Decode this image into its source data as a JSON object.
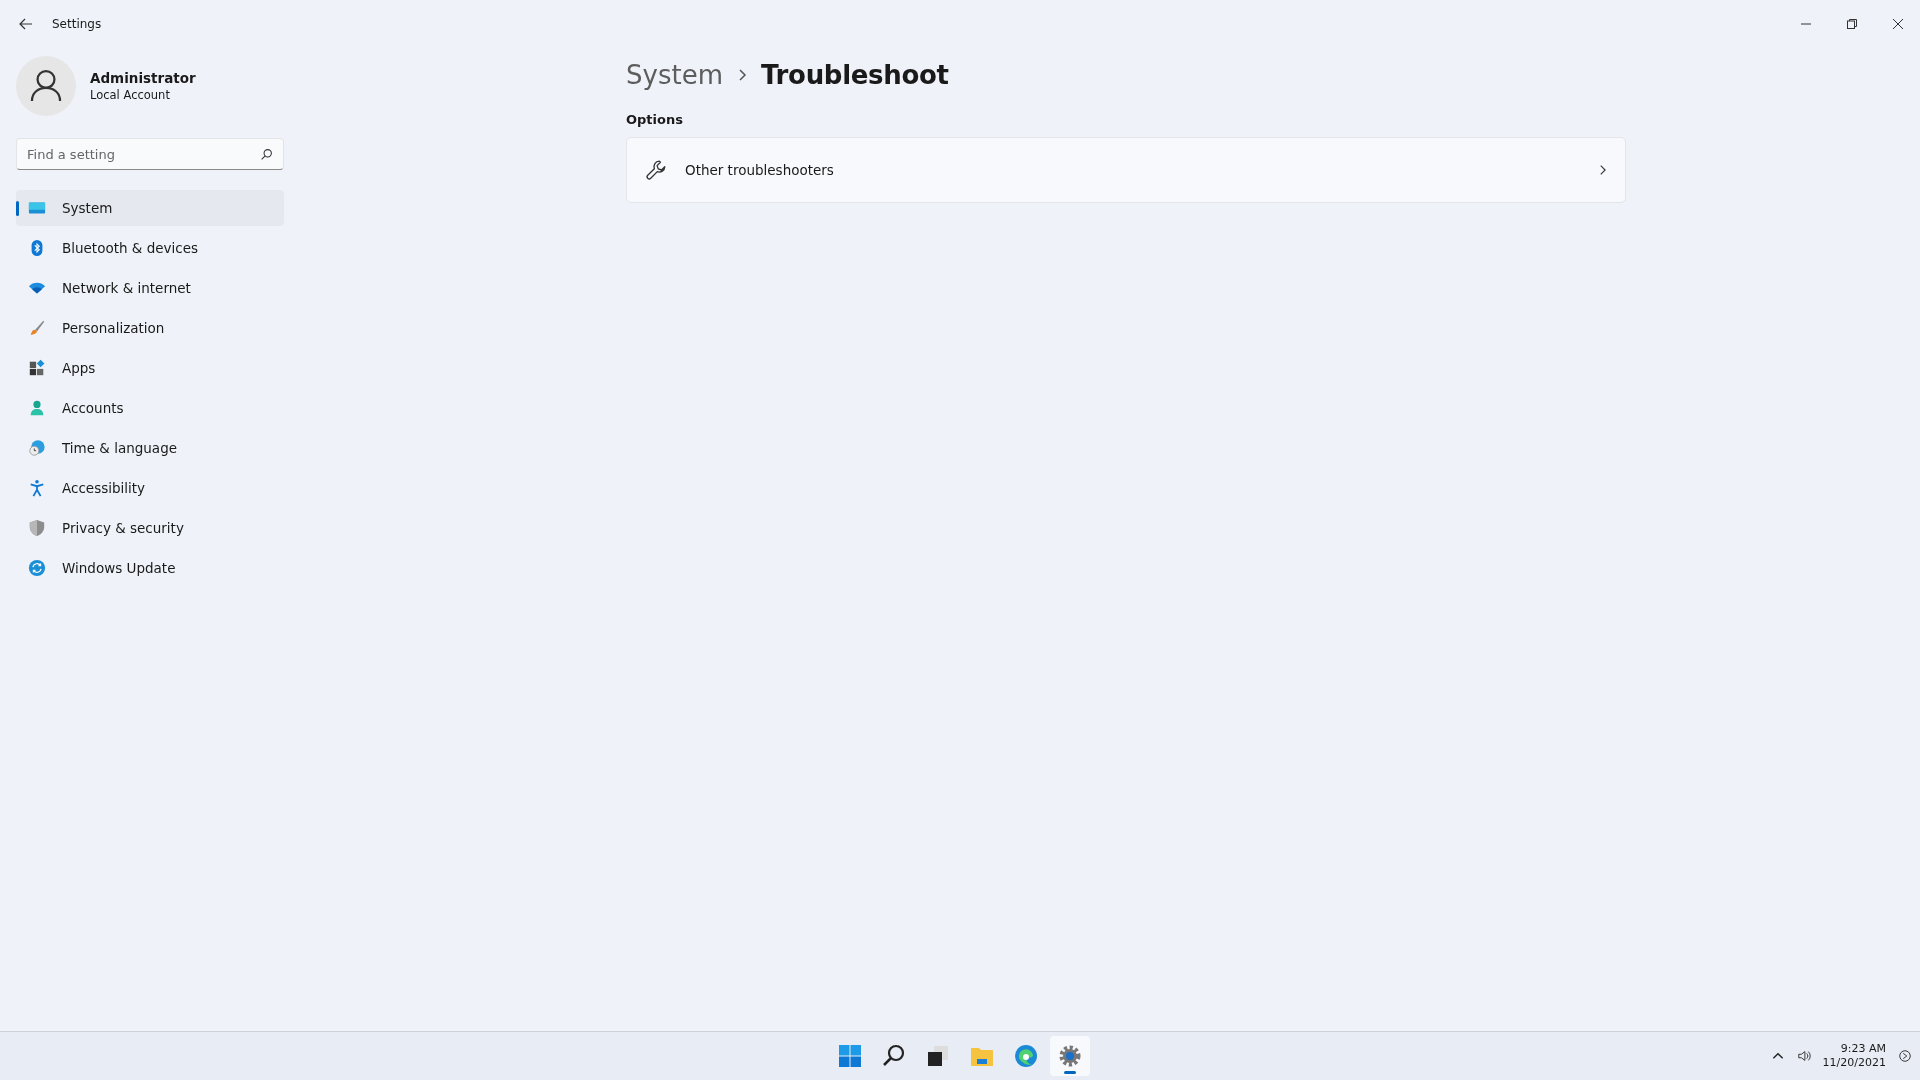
{
  "window": {
    "title": "Settings"
  },
  "account": {
    "name": "Administrator",
    "type": "Local Account"
  },
  "search": {
    "placeholder": "Find a setting"
  },
  "sidebar": {
    "items": [
      {
        "label": "System",
        "kind": "monitor",
        "selected": true
      },
      {
        "label": "Bluetooth & devices",
        "kind": "bluetooth",
        "selected": false
      },
      {
        "label": "Network & internet",
        "kind": "wifi",
        "selected": false
      },
      {
        "label": "Personalization",
        "kind": "brush",
        "selected": false
      },
      {
        "label": "Apps",
        "kind": "apps",
        "selected": false
      },
      {
        "label": "Accounts",
        "kind": "person",
        "selected": false
      },
      {
        "label": "Time & language",
        "kind": "globe",
        "selected": false
      },
      {
        "label": "Accessibility",
        "kind": "figure",
        "selected": false
      },
      {
        "label": "Privacy & security",
        "kind": "shield",
        "selected": false
      },
      {
        "label": "Windows Update",
        "kind": "sync",
        "selected": false
      }
    ]
  },
  "breadcrumb": {
    "parent": "System",
    "current": "Troubleshoot"
  },
  "section": {
    "heading": "Options",
    "items": [
      {
        "label": "Other troubleshooters",
        "kind": "wrench"
      }
    ]
  },
  "taskbar": {
    "apps": [
      {
        "kind": "start",
        "active": false
      },
      {
        "kind": "search",
        "active": false
      },
      {
        "kind": "taskview",
        "active": false
      },
      {
        "kind": "folder",
        "active": false
      },
      {
        "kind": "browser",
        "active": false
      },
      {
        "kind": "gear",
        "active": true
      }
    ],
    "time": "9:23 AM",
    "date": "11/20/2021"
  }
}
